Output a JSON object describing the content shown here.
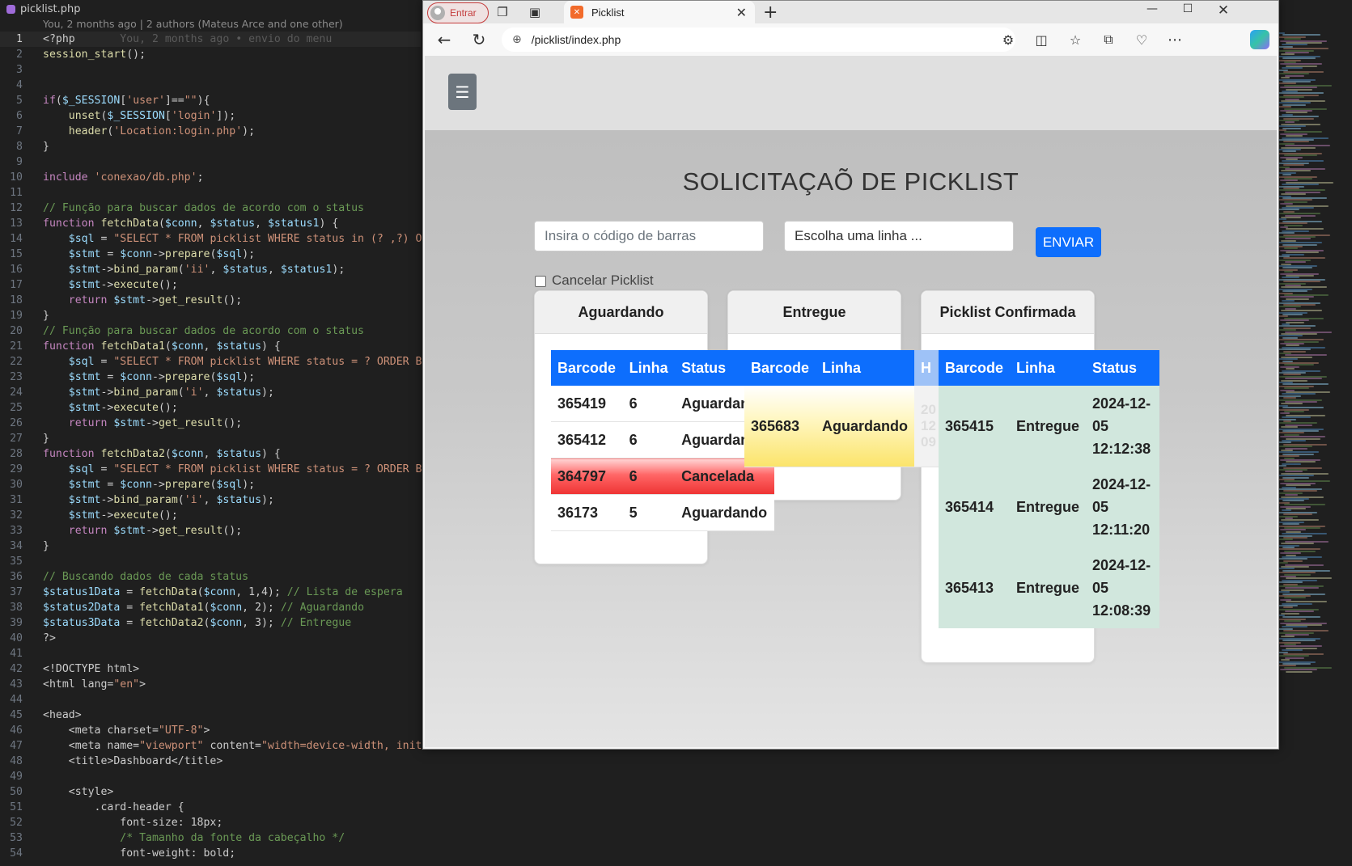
{
  "editor": {
    "tab_label": "picklist.php",
    "blame": "You, 2 months ago | 2 authors (Mateus Arce and one other)",
    "ghost_blame": "You, 2 months ago • envio do menu",
    "code": [
      "<?php",
      "session_start();",
      "",
      "",
      "if($_SESSION['user']==\"\"){",
      "    unset($_SESSION['login']);",
      "    header('Location:login.php');",
      "}",
      "",
      "include 'conexao/db.php';",
      "",
      "// Função para buscar dados de acordo com o status",
      "function fetchData($conn, $status, $status1) {",
      "    $sql = \"SELECT * FROM picklist WHERE status in (? ,?) ORD",
      "    $stmt = $conn->prepare($sql);",
      "    $stmt->bind_param('ii', $status, $status1);",
      "    $stmt->execute();",
      "    return $stmt->get_result();",
      "}",
      "// Função para buscar dados de acordo com o status",
      "function fetchData1($conn, $status) {",
      "    $sql = \"SELECT * FROM picklist WHERE status = ? ORDER BY",
      "    $stmt = $conn->prepare($sql);",
      "    $stmt->bind_param('i', $status);",
      "    $stmt->execute();",
      "    return $stmt->get_result();",
      "}",
      "function fetchData2($conn, $status) {",
      "    $sql = \"SELECT * FROM picklist WHERE status = ? ORDER BY",
      "    $stmt = $conn->prepare($sql);",
      "    $stmt->bind_param('i', $status);",
      "    $stmt->execute();",
      "    return $stmt->get_result();",
      "}",
      "",
      "// Buscando dados de cada status",
      "$status1Data = fetchData($conn, 1,4); // Lista de espera",
      "$status2Data = fetchData1($conn, 2); // Aguardando",
      "$status3Data = fetchData2($conn, 3); // Entregue",
      "?>",
      "",
      "<!DOCTYPE html>",
      "<html lang=\"en\">",
      "",
      "<head>",
      "    <meta charset=\"UTF-8\">",
      "    <meta name=\"viewport\" content=\"width=device-width, initia",
      "    <title>Dashboard</title>",
      "",
      "    <style>",
      "        .card-header {",
      "            font-size: 18px;",
      "            /* Tamanho da fonte da cabeçalho */",
      "            font-weight: bold;"
    ]
  },
  "browser": {
    "signin_label": "Entrar",
    "tab_title": "Picklist",
    "url": "/picklist/index.php",
    "icons": [
      "back-icon",
      "refresh-icon",
      "globe-icon",
      "extensions-icon",
      "split-screen-icon",
      "favorites-icon",
      "collections-icon",
      "browser-essentials-icon",
      "more-icon",
      "copilot-icon"
    ]
  },
  "page": {
    "title": "SOLICITAÇAÕ DE PICKLIST",
    "barcode_placeholder": "Insira o código de barras",
    "line_select": "Escolha uma linha ...",
    "send_label": "ENVIAR",
    "cancel_label": "Cancelar Picklist",
    "accent": "#0d6efd",
    "cards": [
      {
        "title": "Aguardando",
        "columns": [
          "Barcode",
          "Linha",
          "Status"
        ],
        "rows": [
          {
            "barcode": "365419",
            "linha": "6",
            "status": "Aguardando"
          },
          {
            "barcode": "365412",
            "linha": "6",
            "status": "Aguardando"
          },
          {
            "barcode": "364797",
            "linha": "6",
            "status": "Cancelada"
          },
          {
            "barcode": "36173",
            "linha": "5",
            "status": "Aguardando"
          }
        ]
      },
      {
        "title": "Entregue",
        "columns": [
          "Barcode",
          "Linha",
          "H"
        ],
        "rows": [
          {
            "barcode": "365683",
            "linha": "Aguardando",
            "hora": "20 12 09"
          }
        ]
      },
      {
        "title": "Picklist Confirmada",
        "columns": [
          "Barcode",
          "Linha",
          "Status"
        ],
        "rows": [
          {
            "barcode": "365415",
            "linha": "Entregue",
            "status": "2024-12-05 12:12:38"
          },
          {
            "barcode": "365414",
            "linha": "Entregue",
            "status": "2024-12-05 12:11:20"
          },
          {
            "barcode": "365413",
            "linha": "Entregue",
            "status": "2024-12-05 12:08:39"
          }
        ]
      }
    ]
  }
}
